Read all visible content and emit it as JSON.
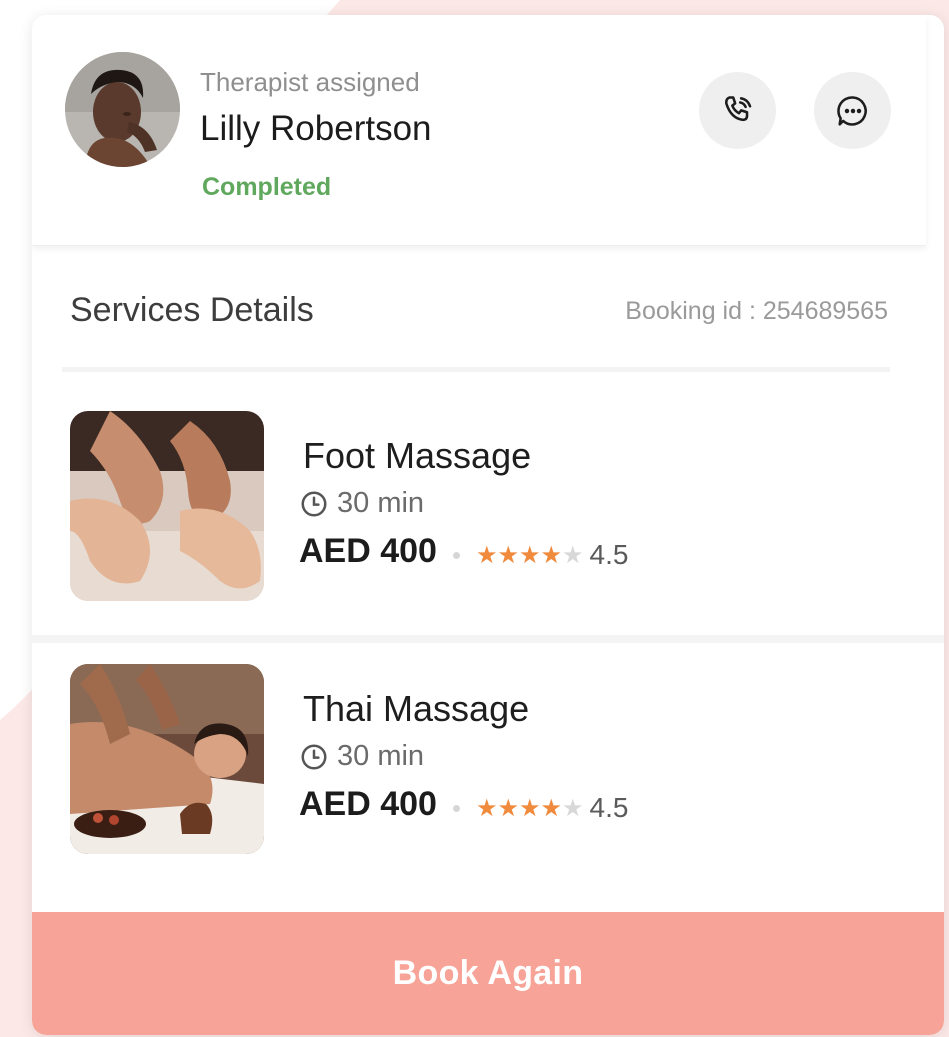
{
  "colors": {
    "accent": "#F8A397",
    "status_completed": "#5FA85D",
    "star": "#F08A3C",
    "star_off": "#D8D8D8",
    "background_shape": "#FCE9E7"
  },
  "therapist": {
    "label": "Therapist assigned",
    "name": "Lilly Robertson",
    "status": "Completed",
    "avatar_icon": "avatar",
    "call_icon": "phone-call-icon",
    "chat_icon": "chat-bubble-icon"
  },
  "services": {
    "title": "Services Details",
    "booking_id": "Booking id : 254689565",
    "items": [
      {
        "name": "Foot Massage",
        "duration": "30 min",
        "price": "AED 400",
        "rating": "4.5",
        "stars_filled": 4,
        "stars_total": 5
      },
      {
        "name": "Thai Massage",
        "duration": "30 min",
        "price": "AED 400",
        "rating": "4.5",
        "stars_filled": 4,
        "stars_total": 5
      }
    ]
  },
  "actions": {
    "book_again": "Book Again"
  }
}
